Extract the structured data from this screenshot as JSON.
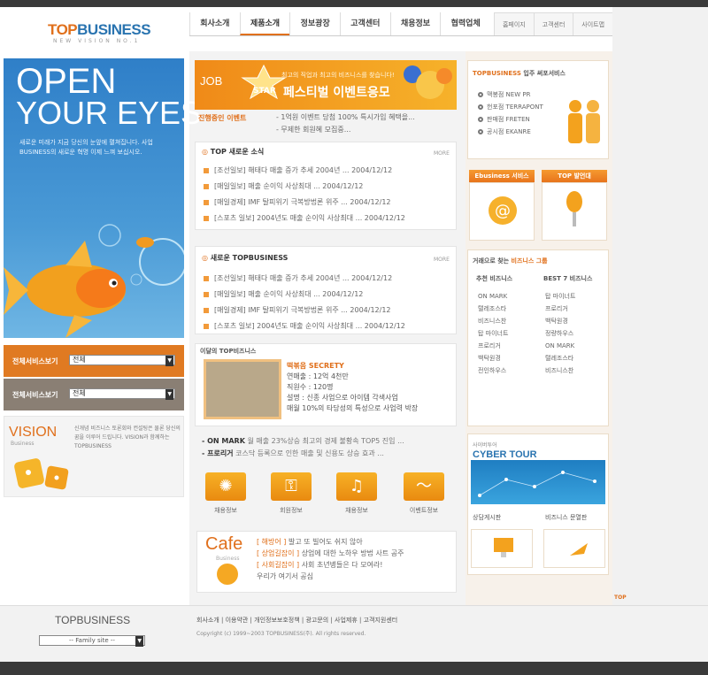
{
  "header": {
    "logo_top": "TOP",
    "logo_business": "BUSINESS",
    "logo_sub": "NEW VISION NO.1",
    "nav": [
      "회사소개",
      "제품소개",
      "정보광장",
      "고객센터",
      "채용정보",
      "협력업체"
    ],
    "util": [
      "홈페이지",
      "고객센터",
      "사이트맵"
    ]
  },
  "hero": {
    "line1": "OPEN",
    "line2": "YOUR EYES",
    "desc": "새로운 미래가 지금 당신의 눈앞에 펼쳐집니다. 사업 BUSINESS의 새로운 혁명 이제 느껴 보십시오."
  },
  "left_selects": [
    {
      "label": "전체서비스보기",
      "value": "전체"
    },
    {
      "label": "전체서비스보기",
      "value": "전체"
    }
  ],
  "vision": {
    "title": "VISION",
    "sub": "Business",
    "desc": "신개념 비즈니스 토론회와 컨설팅은 물론 당신의 꿈을 이루어 드립니다. VISION과 함께하는 TOPBUSINESS"
  },
  "banner": {
    "job": "JOB",
    "star": "STAR",
    "sub": "최고의 직업과 최고의 비즈니스를 찾습니다!",
    "title": "페스티벌 이벤트응모"
  },
  "event": {
    "label": "진행중인 이벤트",
    "lines": [
      "- 1억원 이벤트 당첨 100% 특시가입 혜택을...",
      "- 무제한 회원혜 모집중..."
    ]
  },
  "news1": {
    "title": "TOP 새로운 소식",
    "more": "MORE",
    "items": [
      "[조선일보] 해태다 매출 증가 추세 2004년 ... 2004/12/12",
      "[매일일보] 매출 순이익 사상최대 ... 2004/12/12",
      "[매일경제] IMF 탈피위기 극복방법론 위주 ... 2004/12/12",
      "[스포츠 일보] 2004년도 매출 순이익 사상최대 ... 2004/12/12"
    ]
  },
  "news2": {
    "title": "새로운 TOPBUSINESS",
    "more": "MORE",
    "items": [
      "[조선일보] 해태다 매출 증가 추세 2004년 ... 2004/12/12",
      "[매일일보] 매출 순이익 사상최대 ... 2004/12/12",
      "[매일경제] IMF 탈피위기 극복방법론 위주 ... 2004/12/12",
      "[스포츠 일보] 2004년도 매출 순이익 사상최대 ... 2004/12/12"
    ]
  },
  "feature": {
    "title": "이달의 TOP비즈니스",
    "name": "떡볶음 SECRETY",
    "info": [
      "연매출 : 12억 4천만",
      "직원수 : 120명",
      "설명 : 신종 사업으로 아이템 각색사업",
      "매월 10%의 타당성의 특성으로 사업력 박장"
    ]
  },
  "marks": [
    {
      "label": "- ON MARK",
      "text": "월 매출 23%상승 최고의 경제 불황속 TOP5 진입 ..."
    },
    {
      "label": "- 프로리거",
      "text": "코스닥 등록으로 인한 매출 및 신용도 상승 효과 ..."
    }
  ],
  "icons": [
    {
      "icon": "light",
      "label": "채용정보"
    },
    {
      "icon": "key",
      "label": "회원정보"
    },
    {
      "icon": "bell",
      "label": "채용정보"
    },
    {
      "icon": "swoosh",
      "label": "이벤트정보"
    }
  ],
  "cafe": {
    "title": "Cafe",
    "sub": "Business",
    "lines": [
      {
        "key": "[ 해방어 ]",
        "text": "발고 또 빌어도 쉬지 않아"
      },
      {
        "key": "[ 상업길잡이 ]",
        "text": "상업에 대한 노하우 방법 사트 공주"
      },
      {
        "key": "[ 사회길잡이 ]",
        "text": "사회 초년병들은 다 모여라!"
      },
      {
        "key": "",
        "text": "우리가 여기서 공심"
      }
    ]
  },
  "services": {
    "title_a": "TOPBUSINESS",
    "title_b": "입주 써포서비스",
    "items": [
      "맥봉점 NEW PR",
      "헌포점 TERRAPONT",
      "판매점 FRETEN",
      "공시점 EKANRE"
    ]
  },
  "tabs": [
    "Ebusiness 서비스",
    "TOP 발언대"
  ],
  "rank": {
    "title_a": "거래으로 찾는",
    "title_b": "비즈니스 그룹",
    "col1_title": "추천 비즈니스",
    "col2_title": "BEST 7 비즈니스",
    "col1": [
      "ON MARK",
      "탤레조스타",
      "비즈니스찬",
      "탑 마이너트",
      "프로리거",
      "백탁원경",
      "전인하우스"
    ],
    "col2": [
      "탑 마이너트",
      "프로리거",
      "백탁원경",
      "정량하우스",
      "ON MARK",
      "탤레조스타",
      "비즈니스찬"
    ]
  },
  "cyber": {
    "sub": "사이버투어",
    "title": "CYBER TOUR",
    "bottom": [
      "상담게시판",
      "비즈니스 문열판"
    ]
  },
  "footer": {
    "logo": "TOPBUSINESS",
    "family": "-- Family site --",
    "links": "회사소개 | 이용약관 | 개인정보보호정책 | 광고문의 | 사업제휴 | 고객지원센터",
    "copy": "Copyright (c) 1999~2003 TOPBUSINESS(주). All rights reserved.",
    "top": "TOP"
  },
  "colors": {
    "accent": "#e0701c",
    "blue": "#2a74b0",
    "hero": "#3b8bd0"
  }
}
